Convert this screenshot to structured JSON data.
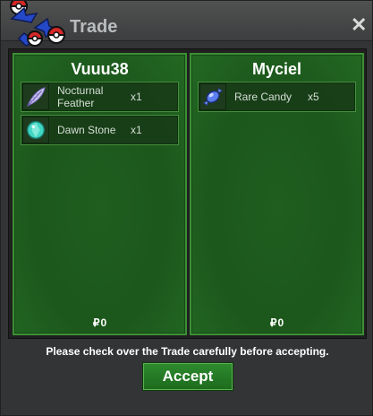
{
  "window": {
    "title": "Trade",
    "close_symbol": "✕",
    "logo_icon": "pokeball-cluster-icon"
  },
  "traders": [
    {
      "name": "Vuuu38",
      "items": [
        {
          "name": "Nocturnal Feather",
          "qty": "x1",
          "icon": "feather-icon"
        },
        {
          "name": "Dawn Stone",
          "qty": "x1",
          "icon": "dawn-stone-icon"
        }
      ],
      "currency_symbol": "₽",
      "money": "0"
    },
    {
      "name": "Myciel",
      "items": [
        {
          "name": "Rare Candy",
          "qty": "x5",
          "icon": "rare-candy-icon"
        }
      ],
      "currency_symbol": "₽",
      "money": "0"
    }
  ],
  "footer": {
    "notice": "Please check over the Trade carefully before accepting.",
    "accept_label": "Accept"
  },
  "colors": {
    "panel_green": "#1c571c",
    "panel_border": "#3c8f34",
    "button_green": "#2e8a2e"
  }
}
